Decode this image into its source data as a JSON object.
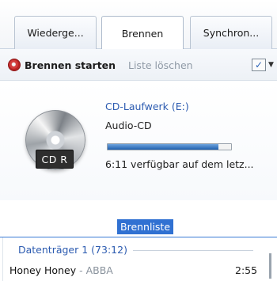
{
  "tabs": [
    {
      "label": "Wiederge...",
      "active": false
    },
    {
      "label": "Brennen",
      "active": true
    },
    {
      "label": "Synchron...",
      "active": false
    }
  ],
  "toolbar": {
    "burn_label": "Brennen starten",
    "clear_label": "Liste löschen",
    "options_icon": "checklist-icon"
  },
  "drive": {
    "name": "CD-Laufwerk (E:)",
    "media_type": "Audio-CD",
    "disc_badge": "CD R",
    "progress_fraction": 0.9,
    "remaining": "6:11 verfügbar auf dem letz..."
  },
  "burn_list": {
    "title": "Brennliste",
    "disc_group": "Datenträger 1 (73:12)",
    "tracks": [
      {
        "title": "Honey Honey",
        "separator": " - ",
        "artist": "ABBA",
        "duration": "2:55"
      }
    ]
  },
  "colors": {
    "accent": "#3071d2",
    "link": "#2c5bb0",
    "burn_icon": "#d23c3c"
  }
}
